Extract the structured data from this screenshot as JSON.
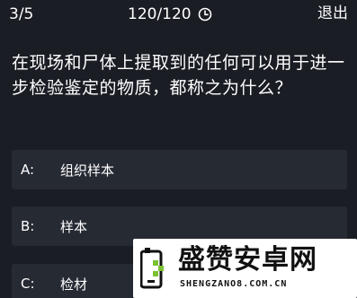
{
  "header": {
    "progress": "3/5",
    "timer": "120/120",
    "timer_icon": "clock-icon",
    "exit_label": "退出"
  },
  "question": {
    "text": "在现场和尸体上提取到的任何可以用于进一步检验鉴定的物质，都称之为什么？"
  },
  "options": [
    {
      "letter": "A:",
      "text": "组织样本"
    },
    {
      "letter": "B:",
      "text": "样本"
    },
    {
      "letter": "C:",
      "text": "检材"
    }
  ],
  "watermark": {
    "name": "盛赞安卓网",
    "url": "SHENGZANO8.COM.CN",
    "accent": "#7ac231"
  },
  "colors": {
    "background": "#1a1d24",
    "option_bg": "#262a33",
    "text": "#ffffff"
  }
}
